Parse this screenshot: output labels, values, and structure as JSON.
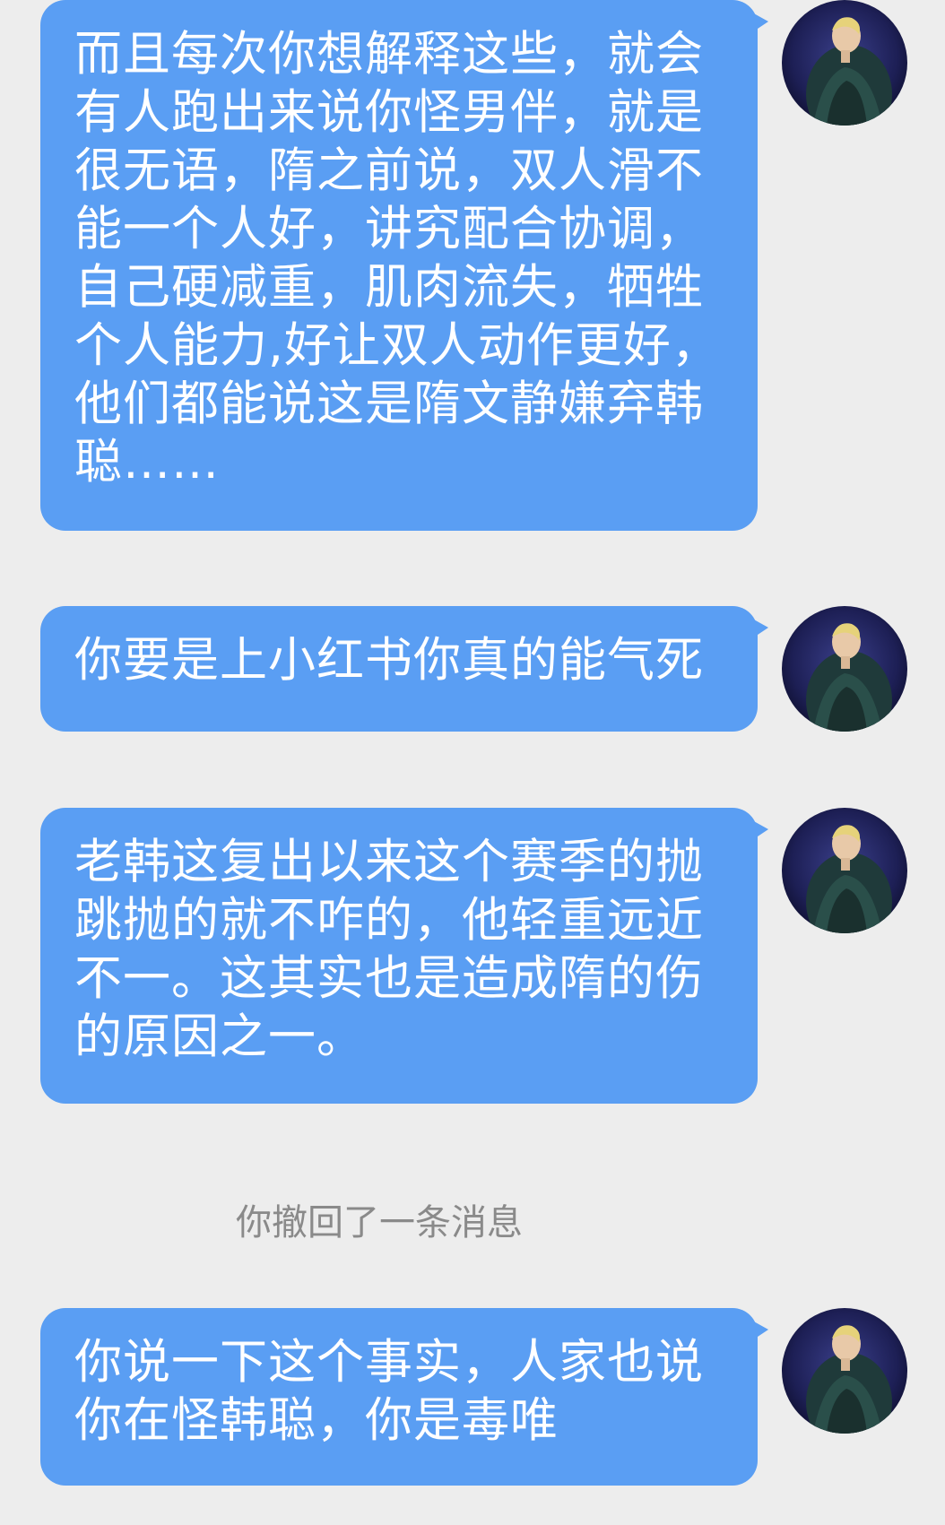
{
  "messages": [
    {
      "text": "而且每次你想解释这些，就会有人跑出来说你怪男伴，就是很无语，隋之前说，双人滑不能一个人好，讲究配合协调，自己硬减重，肌肉流失，牺牲个人能力,好让双人动作更好，他们都能说这是隋文静嫌弃韩聪……"
    },
    {
      "text": "你要是上小红书你真的能气死"
    },
    {
      "text": "老韩这复出以来这个赛季的抛跳抛的就不咋的，他轻重远近不一。这其实也是造成隋的伤的原因之一。"
    },
    {
      "text": "你说一下这个事实，人家也说你在怪韩聪，你是毒唯"
    }
  ],
  "recall_notice": "你撤回了一条消息",
  "colors": {
    "background": "#ededed",
    "bubble": "#5a9ef3",
    "bubble_text": "#ffffff",
    "notice_text": "#8a8a8a"
  },
  "icons": {
    "avatar": "user-avatar-photo"
  }
}
